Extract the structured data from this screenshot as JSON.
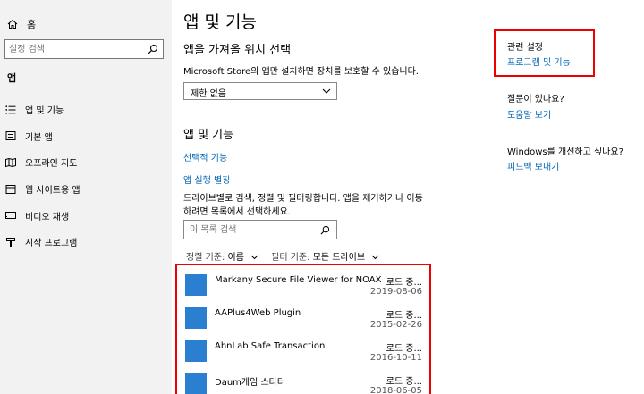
{
  "sidebar": {
    "home_label": "홈",
    "search_placeholder": "설정 검색",
    "section_title": "앱",
    "items": [
      {
        "label": "앱 및 기능"
      },
      {
        "label": "기본 앱"
      },
      {
        "label": "오프라인 지도"
      },
      {
        "label": "웹 사이트용 앱"
      },
      {
        "label": "비디오 재생"
      },
      {
        "label": "시작 프로그램"
      }
    ]
  },
  "main": {
    "title": "앱 및 기능",
    "install_heading": "앱을 가져올 위치 선택",
    "install_desc": "Microsoft Store의 앱만 설치하면 장치를 보호할 수 있습니다.",
    "install_dropdown_value": "제한 없음",
    "apps_heading": "앱 및 기능",
    "optional_features_link": "선택적 기능",
    "app_aliases_link": "앱 실행 별칭",
    "search_desc_line1": "드라이브별로 검색, 정렬 및 필터링합니다. 앱을 제거하거나 이동",
    "search_desc_line2": "하려면 목록에서 선택하세요.",
    "list_search_placeholder": "이 목록 검색",
    "sort_label": "정렬 기준:",
    "sort_value": "이름",
    "filter_label": "필터 기준:",
    "filter_value": "모든 드라이브",
    "apps": [
      {
        "name": "Markany Secure File Viewer for NOAX(re...",
        "size": "로드 중...",
        "date": "2019-08-06"
      },
      {
        "name": "AAPlus4Web Plugin",
        "size": "로드 중...",
        "date": "2015-02-26"
      },
      {
        "name": "AhnLab Safe Transaction",
        "size": "로드 중...",
        "date": "2016-10-11"
      },
      {
        "name": "Daum게임 스타터",
        "size": "로드 중...",
        "date": "2018-06-05"
      }
    ]
  },
  "right": {
    "related_title": "관련 설정",
    "related_link": "프로그램 및 기능",
    "question_title": "질문이 있나요?",
    "help_link": "도움말 보기",
    "improve_title": "Windows를 개선하고 싶나요?",
    "feedback_link": "피드백 보내기"
  },
  "colors": {
    "accent": "#0066b4",
    "highlight_border": "#e00000",
    "app_icon": "#2a7fd1",
    "sidebar_bg": "#f2f2f2"
  }
}
